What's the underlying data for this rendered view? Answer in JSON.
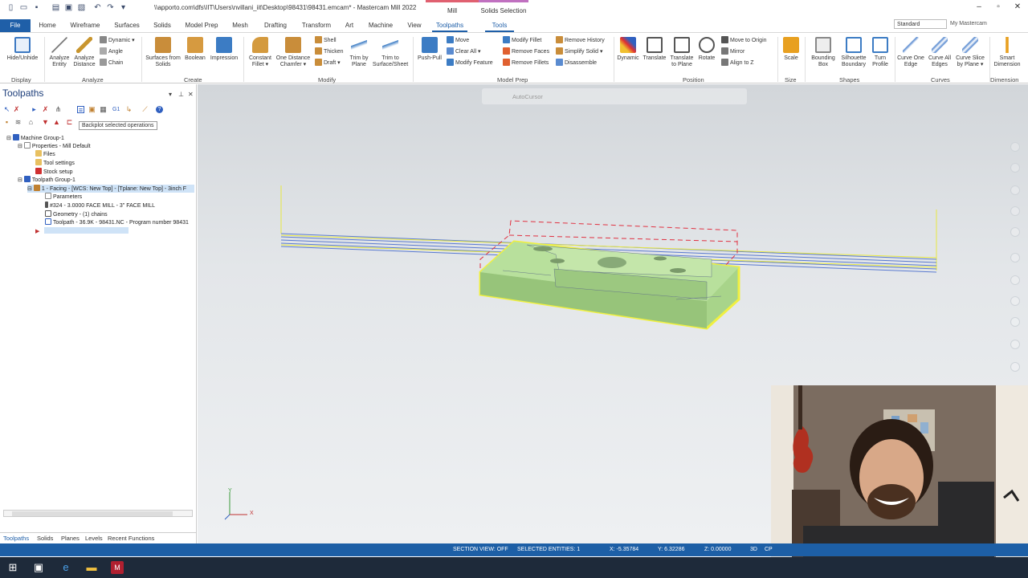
{
  "window": {
    "title": "\\\\apporto.com\\dfs\\IIT\\Users\\nvillani_iit\\Desktop\\98431\\98431.emcam* - Mastercam Mill 2022",
    "context_mill": "Mill",
    "context_solids": "Solids Selection"
  },
  "menu": {
    "tabs": [
      "File",
      "Home",
      "Wireframe",
      "Surfaces",
      "Solids",
      "Model Prep",
      "Mesh",
      "Drafting",
      "Transform",
      "Art",
      "Machine",
      "Toolpaths",
      "Tools"
    ],
    "active": "Toolpaths",
    "workspace": "Standard",
    "my_mastercam": "My Mastercam"
  },
  "ribbon": {
    "groups": {
      "display": "Display",
      "analyze": "Analyze",
      "create": "Create",
      "modify": "Modify",
      "model_prep": "Model Prep",
      "position": "Position",
      "size": "Size",
      "shapes": "Shapes",
      "curves": "Curves",
      "dimension": "Dimension"
    },
    "display": {
      "hide_unhide": "Hide/Unhide"
    },
    "analyze": {
      "analyze_entity": "Analyze Entity",
      "analyze_distance": "Analyze Distance",
      "dynamic": "Dynamic",
      "angle": "Angle",
      "chain": "Chain"
    },
    "create": {
      "surfaces_from_solids": "Surfaces from Solids",
      "boolean": "Boolean",
      "impression": "Impression"
    },
    "modify": {
      "constant_fillet": "Constant Fillet",
      "one_distance_chamfer": "One Distance Chamfer",
      "shell": "Shell",
      "thicken": "Thicken",
      "draft": "Draft",
      "trim_to_plane": "Trim by Plane",
      "trim_to_surface": "Trim to Surface/Sheet"
    },
    "model_prep": {
      "push_pull": "Push-Pull",
      "move": "Move",
      "clear_all": "Clear All",
      "modify_feature": "Modify Feature",
      "modify_fillet": "Modify Fillet",
      "remove_faces": "Remove Faces",
      "remove_fillets": "Remove Fillets",
      "remove_history": "Remove History",
      "simplify_solid": "Simplify Solid",
      "disassemble": "Disassemble"
    },
    "position": {
      "dynamic": "Dynamic",
      "translate": "Translate",
      "translate_to_plane": "Translate to Plane",
      "rotate": "Rotate",
      "move_to_origin": "Move to Origin",
      "mirror": "Mirror",
      "align_to_z": "Align to Z"
    },
    "size": {
      "scale": "Scale"
    },
    "shapes": {
      "bounding_box": "Bounding Box",
      "silhouette_boundary": "Silhouette Boundary",
      "turn_profile": "Turn Profile"
    },
    "curves": {
      "curve_one_edge": "Curve One Edge",
      "curve_all_edges": "Curve All Edges",
      "curve_slice": "Curve Slice by Plane"
    },
    "dimension": {
      "smart_dimension": "Smart Dimension"
    }
  },
  "toolpaths_panel": {
    "title": "Toolpaths",
    "tooltip": "Backplot selected operations",
    "tree": [
      "Machine Group-1",
      "Properties - Mill Default",
      "Files",
      "Tool settings",
      "Stock setup",
      "Toolpath Group-1",
      "1 - Facing - [WCS: New Top] - [Tplane: New Top] - 3inch F",
      "Parameters",
      "#324 - 3.0000 FACE MILL - 3\" FACE MILL",
      "Geometry - (1) chains",
      "Toolpath - 36.9K - 98431.NC - Program number 98431"
    ],
    "bottom_tabs": [
      "Toolpaths",
      "Solids",
      "Planes",
      "Levels",
      "Recent Functions"
    ]
  },
  "viewport": {
    "autocursor": "AutoCursor",
    "axis_y": "Y",
    "axis_x": "X"
  },
  "status": {
    "section_view": "SECTION VIEW: OFF",
    "selected": "SELECTED ENTITIES: 1",
    "x": "X:   -5.35784",
    "y": "Y:   6.32286",
    "z": "Z:   0.00000",
    "mode": "3D",
    "cplane": "CP"
  },
  "colors": {
    "accent": "#1f5fa8",
    "status": "#1d5fa6",
    "part_fill": "#a8d48a",
    "highlight": "#f0f040",
    "stock": "#e03040"
  }
}
